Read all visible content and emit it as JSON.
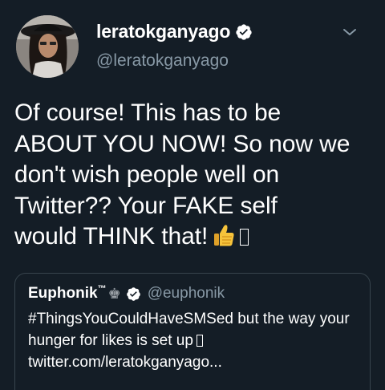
{
  "tweet": {
    "author": {
      "display_name": "leratokganyago",
      "handle": "@leratokganyago",
      "verified": true,
      "avatar_icon": "profile-photo"
    },
    "menu_icon": "chevron-down-icon",
    "text": "Of course! This has to be\nABOUT YOU NOW! So now we\ndon't wish people well on\nTwitter?? Your FAKE self\nwould THINK that!",
    "trailing_emoji": "👍",
    "trailing_missing_glyph": "missing-glyph-icon"
  },
  "quoted_tweet": {
    "display_name": "Euphonik",
    "name_suffix": "™",
    "name_emoji": "♚",
    "verified": true,
    "handle": "@euphonik",
    "text": "#ThingsYouCouldHaveSMSed but the way your hunger for likes is set up",
    "link": "twitter.com/leratokganyago..."
  },
  "colors": {
    "background": "#141d26",
    "text": "#ffffff",
    "secondary_text": "#8899a6",
    "border": "#38444d",
    "verified_badge": "#ffffff"
  }
}
